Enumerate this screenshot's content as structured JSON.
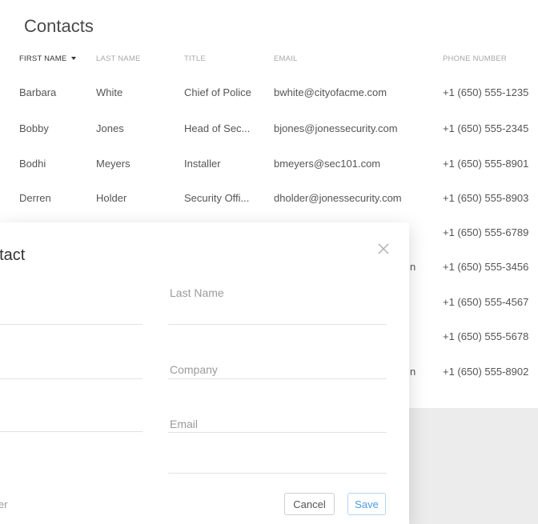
{
  "page": {
    "title": "Contacts"
  },
  "table": {
    "headers": {
      "first_name": "FIRST NAME",
      "last_name": "LAST NAME",
      "title": "TITLE",
      "email": "EMAIL",
      "phone": "PHONE NUMBER"
    },
    "rows": [
      {
        "first": "Barbara",
        "last": "White",
        "title": "Chief of Police",
        "email": "bwhite@cityofacme.com",
        "phone": "+1 (650) 555-1235"
      },
      {
        "first": "Bobby",
        "last": "Jones",
        "title": "Head of Sec...",
        "email": "bjones@jonessecurity.com",
        "phone": "+1 (650) 555-2345"
      },
      {
        "first": "Bodhi",
        "last": "Meyers",
        "title": "Installer",
        "email": "bmeyers@sec101.com",
        "phone": "+1 (650) 555-8901"
      },
      {
        "first": "Derren",
        "last": "Holder",
        "title": "Security Offi...",
        "email": "dholder@jonessecurity.com",
        "phone": "+1 (650) 555-8903"
      }
    ],
    "hidden_rows": [
      {
        "email_tail": "",
        "phone": "+1 (650) 555-6789"
      },
      {
        "email_tail": "n",
        "phone": "+1 (650) 555-3456"
      },
      {
        "email_tail": "",
        "phone": "+1 (650) 555-4567"
      },
      {
        "email_tail": "",
        "phone": "+1 (650) 555-5678"
      },
      {
        "email_tail": "n",
        "phone": "+1 (650) 555-8902"
      }
    ]
  },
  "modal": {
    "title_visible": "ntact",
    "fields": {
      "last_name_placeholder": "Last Name",
      "company_placeholder": "Company",
      "email_placeholder": "Email"
    },
    "footer_left_text": "er",
    "cancel_label": "Cancel",
    "save_label": "Save"
  },
  "colors": {
    "accent": "#4d9be0",
    "background": "#ececec"
  }
}
